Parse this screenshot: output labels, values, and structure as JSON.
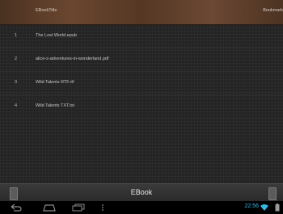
{
  "header": {
    "col_title": "EBookTitle",
    "col_bookmark": "Bookmark"
  },
  "list": {
    "rows": [
      {
        "num": "1",
        "name": "The Lost World.epub"
      },
      {
        "num": "2",
        "name": "alice-s-adventures-in-wonderland.pdf"
      },
      {
        "num": "3",
        "name": "Wild Talents RTF.rtf"
      },
      {
        "num": "4",
        "name": "Wild Talents TXT.txt"
      }
    ]
  },
  "bottombar": {
    "title": "EBook"
  },
  "navbar": {
    "clock": "22:56"
  },
  "icons": {
    "back": "back-icon",
    "home": "home-icon",
    "recent": "recent-apps-icon",
    "menu": "menu-icon",
    "wifi": "wifi-icon",
    "battery": "battery-icon"
  },
  "colors": {
    "header_wood": "#5e3f2a",
    "clock_blue": "#33b5e5"
  }
}
